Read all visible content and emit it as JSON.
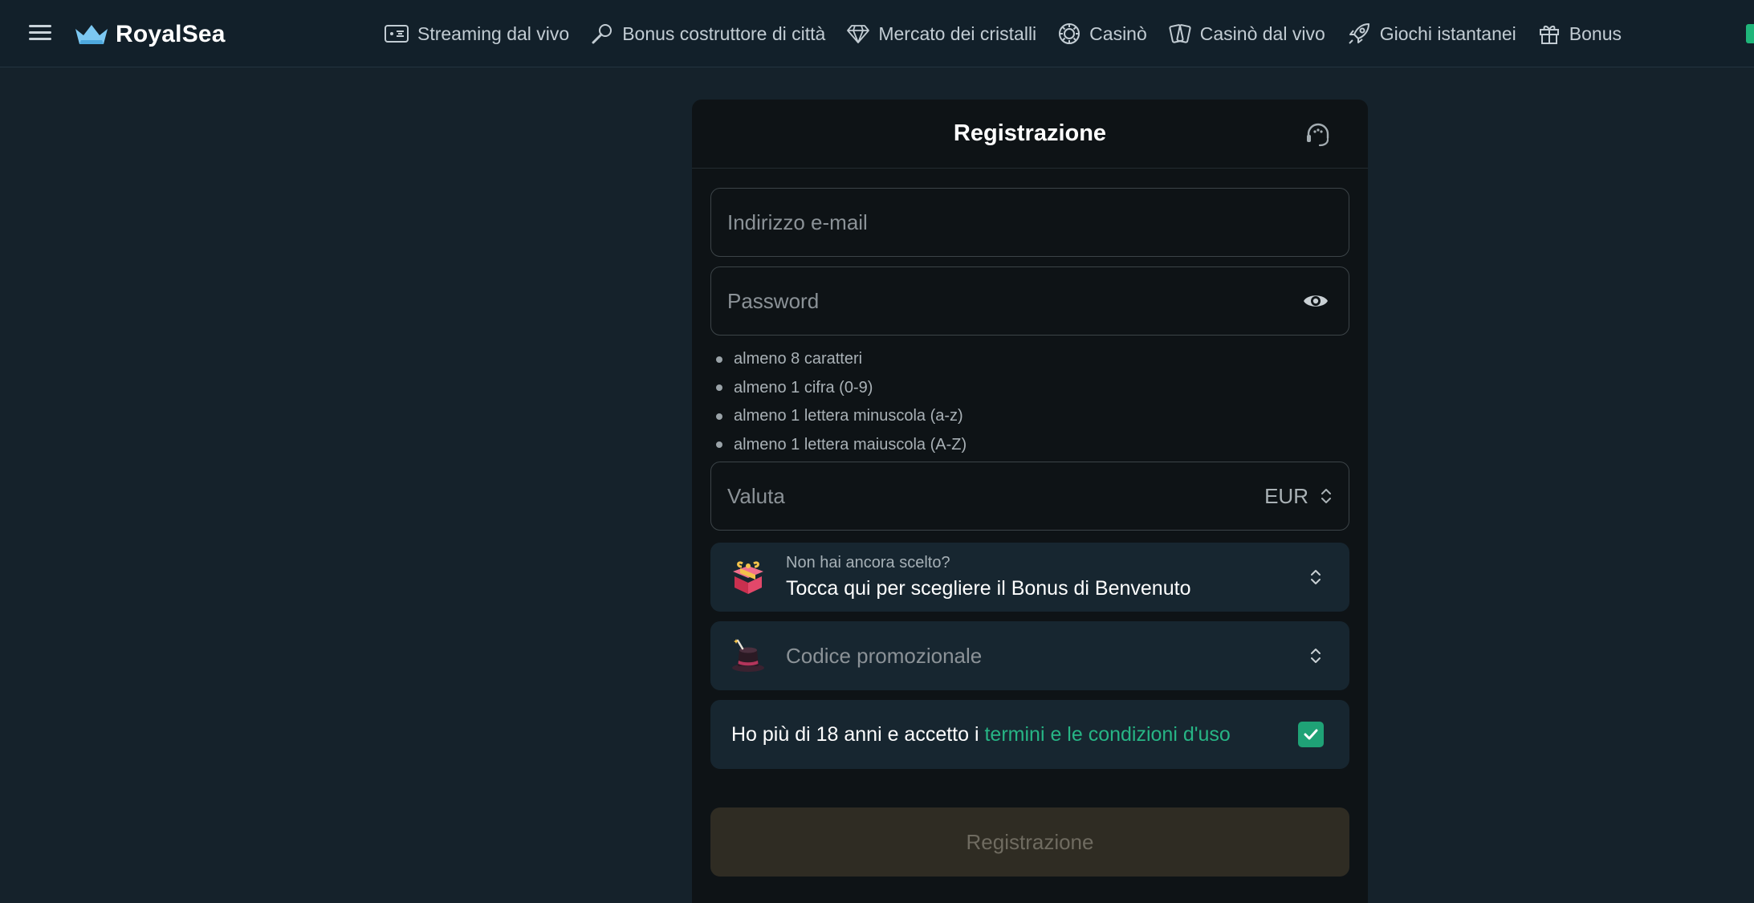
{
  "header": {
    "brand": "RoyalSea",
    "nav": [
      {
        "label": "Streaming dal vivo",
        "icon": "live-stream-icon"
      },
      {
        "label": "Bonus costruttore di città",
        "icon": "magnifier-tool-icon"
      },
      {
        "label": "Mercato dei cristalli",
        "icon": "diamond-icon"
      },
      {
        "label": "Casinò",
        "icon": "poker-chip-icon"
      },
      {
        "label": "Casinò dal vivo",
        "icon": "cards-icon"
      },
      {
        "label": "Giochi istantanei",
        "icon": "rocket-icon"
      },
      {
        "label": "Bonus",
        "icon": "gift-icon"
      }
    ]
  },
  "form": {
    "title": "Registrazione",
    "email_placeholder": "Indirizzo e-mail",
    "password_placeholder": "Password",
    "password_rules": [
      "almeno 8 caratteri",
      "almeno 1 cifra (0-9)",
      "almeno 1 lettera minuscola (a-z)",
      "almeno 1 lettera maiuscola (A-Z)"
    ],
    "currency_label": "Valuta",
    "currency_value": "EUR",
    "bonus_subtitle": "Non hai ancora scelto?",
    "bonus_title": "Tocca qui per scegliere il Bonus di Benvenuto",
    "promo_label": "Codice promozionale",
    "terms_prefix": "Ho più di 18 anni e accetto i ",
    "terms_link": "termini e le condizioni d'uso",
    "terms_checked": true,
    "submit_label": "Registrazione"
  },
  "colors": {
    "page_bg": "#15222b",
    "panel_bg": "#0e1316",
    "accent_green": "#27b585",
    "card_bg": "#172630"
  }
}
